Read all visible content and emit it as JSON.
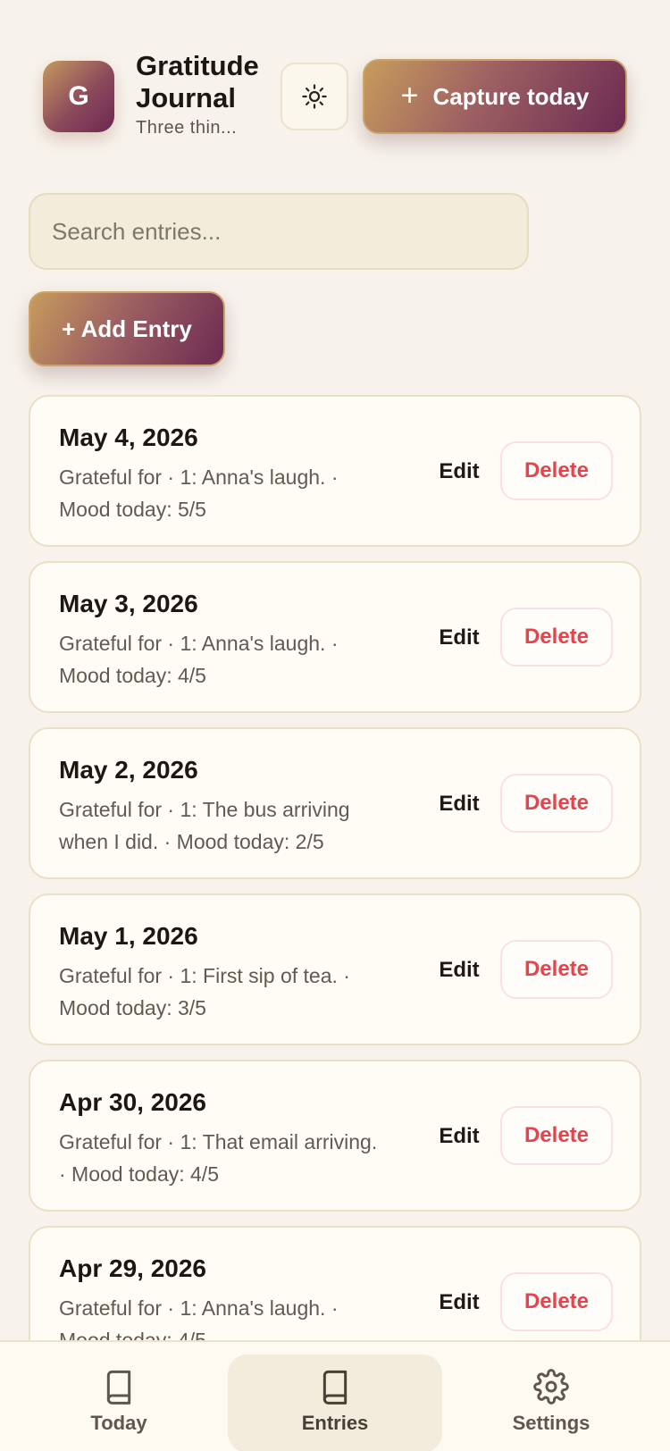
{
  "header": {
    "logo_letter": "G",
    "title": "Gratitude Journal",
    "subtitle": "Three thin...",
    "theme_icon": "sun-icon",
    "capture_label": "Capture today"
  },
  "search": {
    "placeholder": "Search entries..."
  },
  "add_entry_label": "+ Add Entry",
  "entries": [
    {
      "date": "May 4, 2026",
      "summary": "Grateful for · 1: Anna's laugh. · Mood today: 5/5",
      "edit": "Edit",
      "delete": "Delete"
    },
    {
      "date": "May 3, 2026",
      "summary": "Grateful for · 1: Anna's laugh. · Mood today: 4/5",
      "edit": "Edit",
      "delete": "Delete"
    },
    {
      "date": "May 2, 2026",
      "summary": "Grateful for · 1: The bus arriving when I did. · Mood today: 2/5",
      "edit": "Edit",
      "delete": "Delete"
    },
    {
      "date": "May 1, 2026",
      "summary": "Grateful for · 1: First sip of tea. · Mood today: 3/5",
      "edit": "Edit",
      "delete": "Delete"
    },
    {
      "date": "Apr 30, 2026",
      "summary": "Grateful for · 1: That email arriving. · Mood today: 4/5",
      "edit": "Edit",
      "delete": "Delete"
    },
    {
      "date": "Apr 29, 2026",
      "summary": "Grateful for · 1: Anna's laugh. · Mood today: 4/5",
      "edit": "Edit",
      "delete": "Delete"
    }
  ],
  "nav": {
    "items": [
      {
        "label": "Today",
        "icon": "book-icon"
      },
      {
        "label": "Entries",
        "icon": "book-icon",
        "active": true
      },
      {
        "label": "Settings",
        "icon": "gear-icon"
      }
    ]
  },
  "colors": {
    "background": "#f7f3ec",
    "accent_gradient_start": "#c79c5c",
    "accent_gradient_end": "#6c2a52",
    "delete_red": "#e6444c"
  }
}
